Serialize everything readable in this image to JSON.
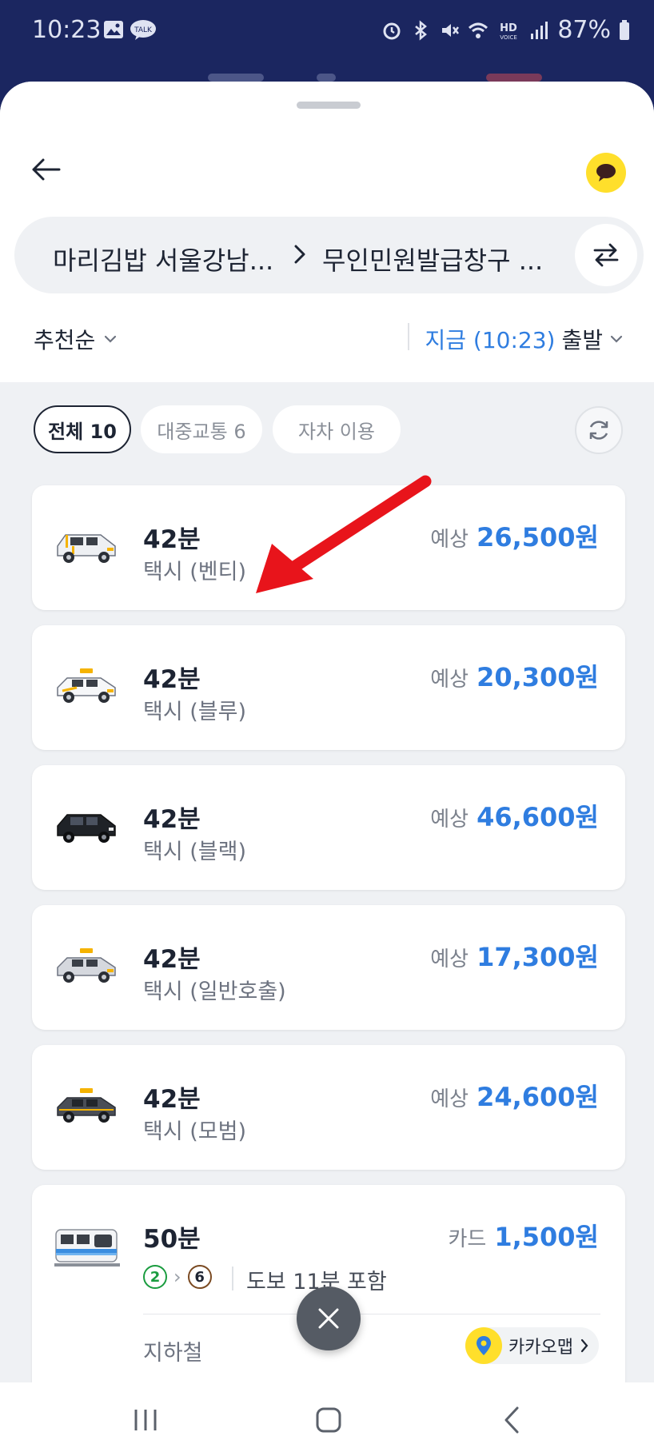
{
  "status_bar": {
    "time": "10:23",
    "battery": "87%"
  },
  "header": {
    "route_from": "마리김밥 서울강남...",
    "route_to": "무인민원발급창구 ..."
  },
  "sort": {
    "label": "추천순"
  },
  "departure": {
    "time_label": "지금 (10:23)",
    "suffix": "출발"
  },
  "filters": [
    {
      "label": "전체 10",
      "active": true
    },
    {
      "label": "대중교통 6",
      "active": false
    },
    {
      "label": "자차 이용",
      "active": false
    }
  ],
  "results": [
    {
      "duration": "42분",
      "mode": "택시 (벤티)",
      "price_label": "예상",
      "price": "26,500원",
      "vehicle": "taxi-venti-icon"
    },
    {
      "duration": "42분",
      "mode": "택시 (블루)",
      "price_label": "예상",
      "price": "20,300원",
      "vehicle": "taxi-blue-icon"
    },
    {
      "duration": "42분",
      "mode": "택시 (블랙)",
      "price_label": "예상",
      "price": "46,600원",
      "vehicle": "taxi-black-icon"
    },
    {
      "duration": "42분",
      "mode": "택시 (일반호출)",
      "price_label": "예상",
      "price": "17,300원",
      "vehicle": "taxi-general-icon"
    },
    {
      "duration": "42분",
      "mode": "택시 (모범)",
      "price_label": "예상",
      "price": "24,600원",
      "vehicle": "taxi-deluxe-icon"
    }
  ],
  "subway": {
    "duration": "50분",
    "price_label": "카드",
    "price": "1,500원",
    "lines": [
      "2",
      "6"
    ],
    "line_colors": [
      "#1a9c3f",
      "#7a4a22"
    ],
    "walk": "도보 11분 포함",
    "type": "지하철",
    "map_button": "카카오맵"
  },
  "colors": {
    "accent": "#2f7de0",
    "kakao_yellow": "#ffdf2b",
    "annotation_arrow": "#e8141b"
  }
}
